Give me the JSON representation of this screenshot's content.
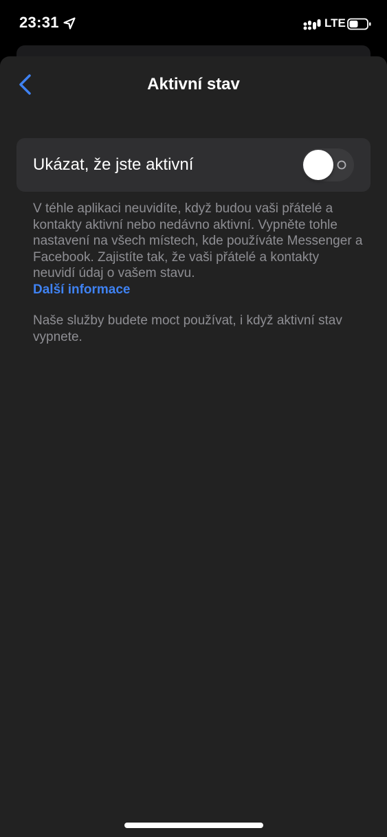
{
  "status_bar": {
    "time": "23:31",
    "network": "LTE",
    "icons": [
      "location-arrow-icon",
      "signal-icon",
      "battery-icon"
    ]
  },
  "nav": {
    "title": "Aktivní stav",
    "back_icon": "chevron-left-icon"
  },
  "setting": {
    "label": "Ukázat, že jste aktivní",
    "toggle_on": false
  },
  "description": {
    "text": "V téhle aplikaci neuvidíte, když budou vaši přátelé a kontakty aktivní nebo nedávno aktivní. Vypněte tohle nastavení na všech místech, kde používáte Messenger a Facebook. Zajistíte tak, že vaši přátelé a kontakty neuvidí údaj o vašem stavu.",
    "link": "Další informace"
  },
  "note": {
    "text": "Naše služby budete moct používat, i když aktivní stav vypnete."
  },
  "colors": {
    "background": "#000000",
    "sheet": "#222222",
    "card": "#2f2f31",
    "accent": "#3f82f2",
    "secondary_text": "#8e8e93"
  }
}
